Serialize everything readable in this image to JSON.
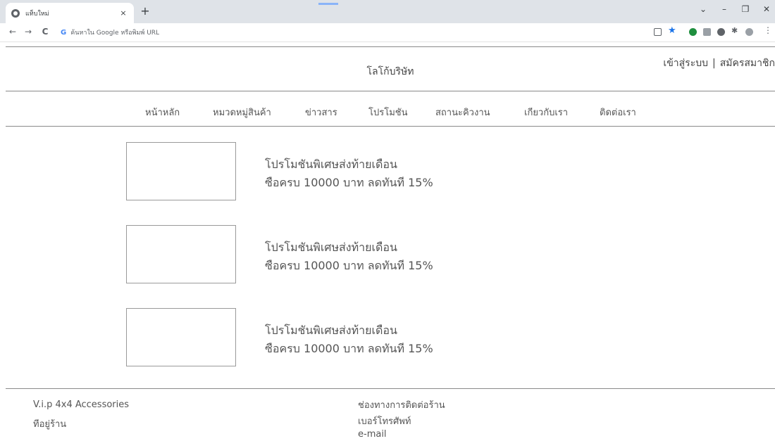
{
  "browser": {
    "tab_title": "แท็บใหม่",
    "tab_close": "×",
    "new_tab": "+",
    "window_controls": {
      "dropdown": "⌄",
      "minimize": "–",
      "restore": "❐",
      "close": "✕"
    },
    "nav": {
      "back": "←",
      "forward": "→",
      "reload": "C"
    },
    "omnibox": {
      "google_mark": "G",
      "placeholder": "ค้นหาใน Google หรือพิมพ์ URL"
    }
  },
  "header": {
    "logo_text": "โลโก้บริษัท",
    "login": "เข้าสู่ระบบ",
    "separator": "|",
    "register": "สมัครสมาชิก"
  },
  "menu": {
    "items": [
      "หน้าหลัก",
      "หมวดหมู่สินค้า",
      "ข่าวสาร",
      "โปรโมชัน",
      "สถานะคิวงาน",
      "เกียวกับเรา",
      "ติดต่อเรา"
    ]
  },
  "promotions": [
    {
      "title": "โปรโมชันพิเศษส่งท้ายเดือน",
      "description": "ซือครบ 10000 บาท ลดทันที 15%"
    },
    {
      "title": "โปรโมชันพิเศษส่งท้ายเดือน",
      "description": "ซือครบ 10000 บาท ลดทันที 15%"
    },
    {
      "title": "โปรโมชันพิเศษส่งท้ายเดือน",
      "description": "ซือครบ 10000 บาท ลดทันที 15%"
    }
  ],
  "footer": {
    "shop_name": "V.i.p 4x4 Accessories",
    "address_label": "ทีอยู่ร้าน",
    "contact_heading": "ช่องทางการติดต่อร้าน",
    "phone_label": "เบอร์โทรศัพท์",
    "email_label": "e-mail"
  }
}
